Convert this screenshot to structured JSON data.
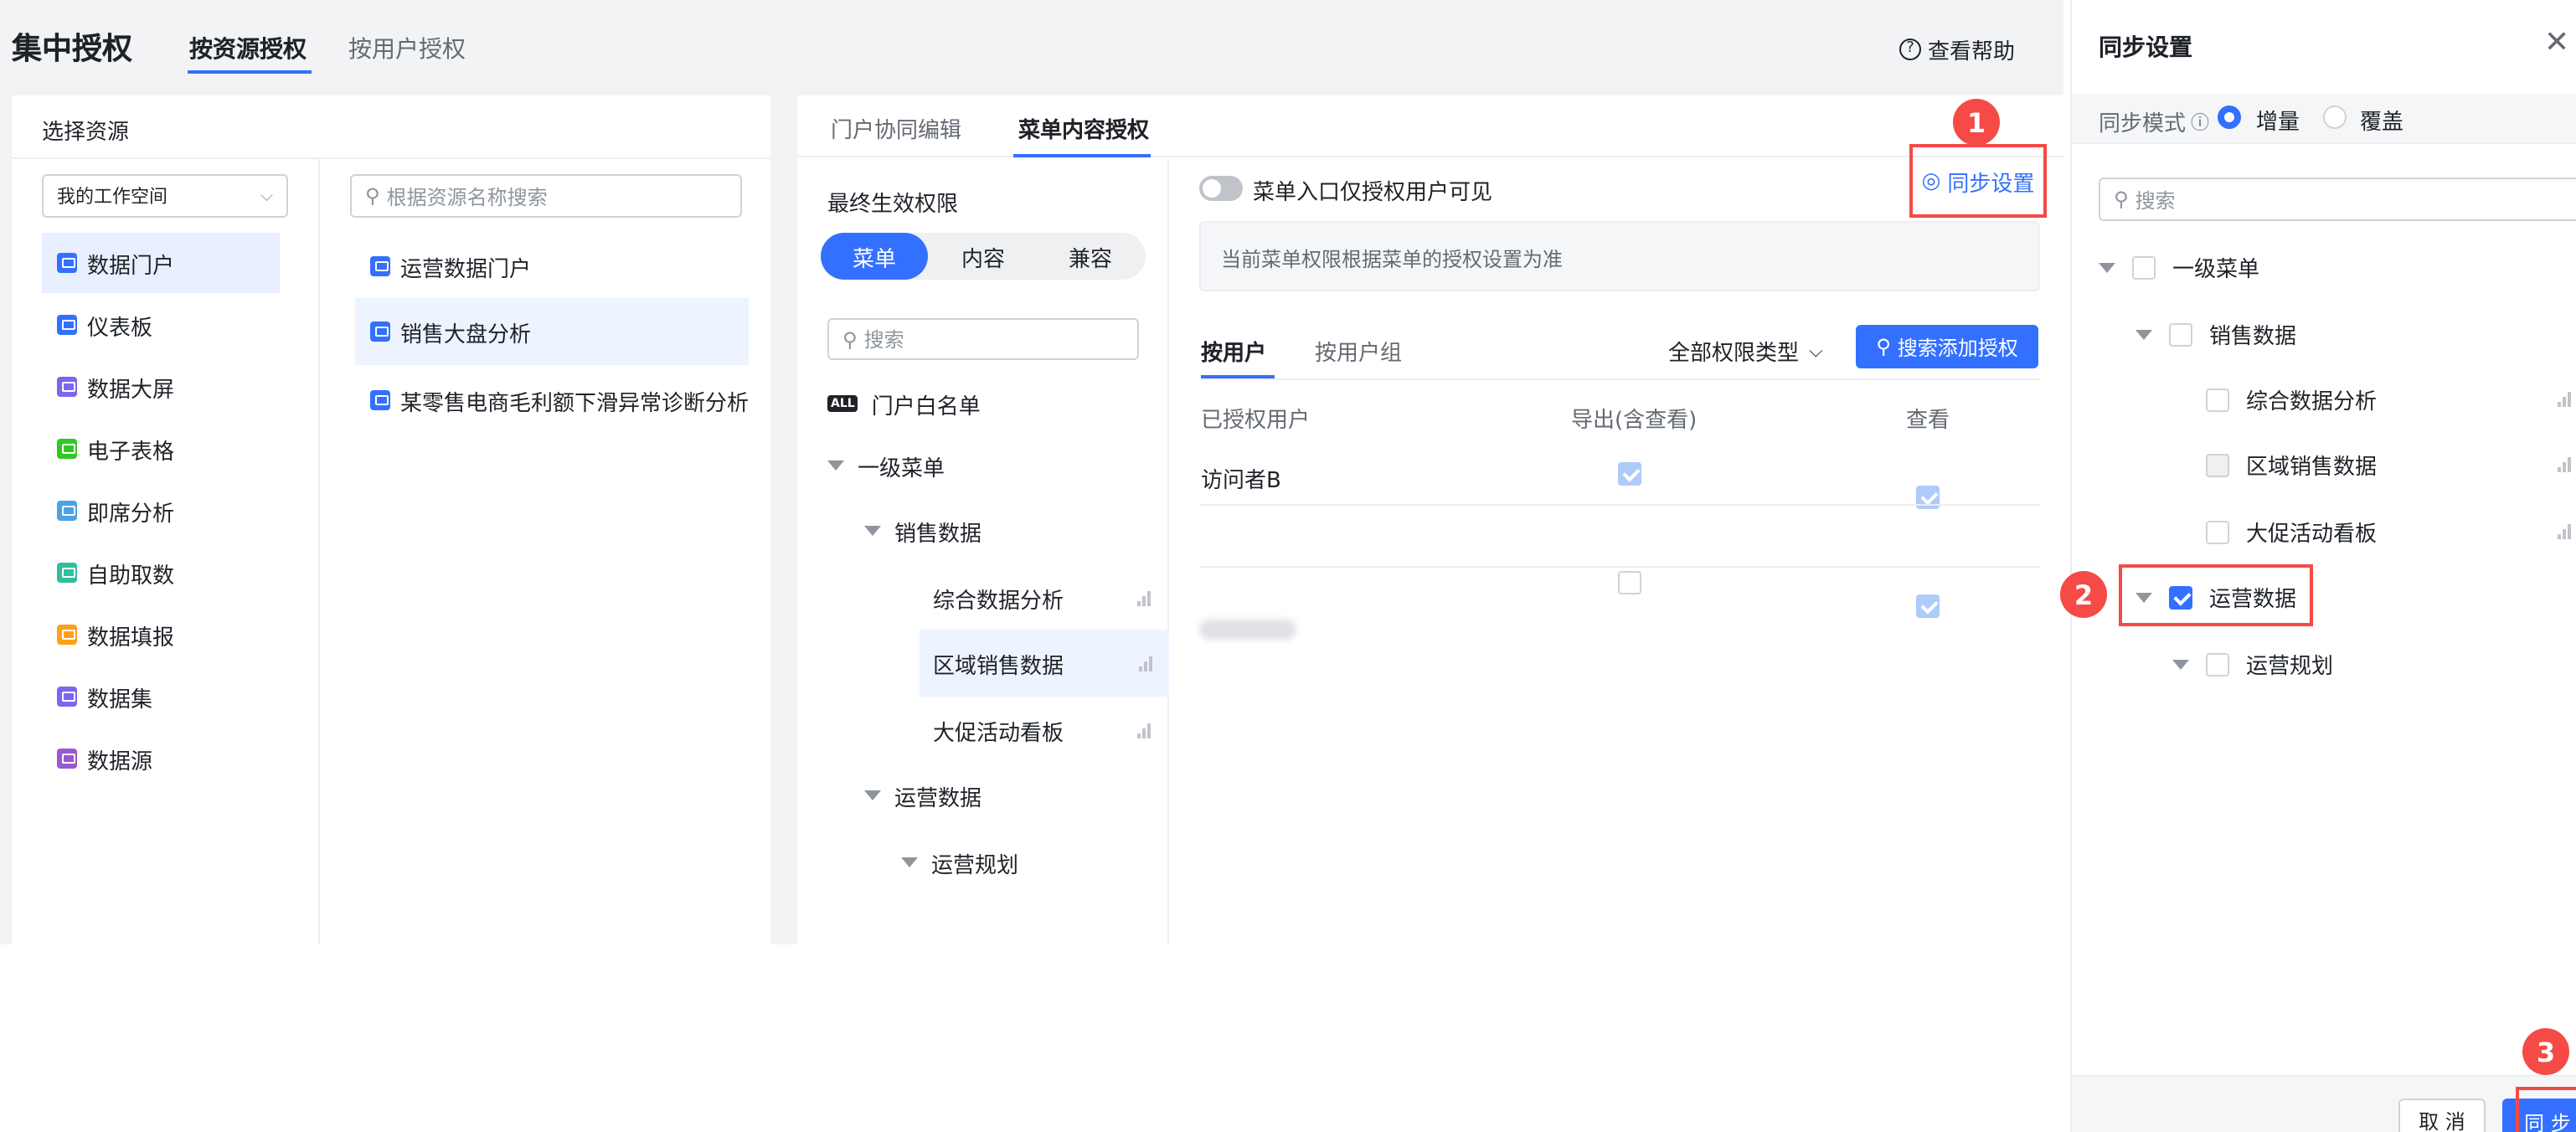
{
  "header": {
    "title": "集中授权",
    "tabs": [
      "按资源授权",
      "按用户授权"
    ],
    "help": "查看帮助"
  },
  "left": {
    "title": "选择资源",
    "workspace": "我的工作空间",
    "search_placeholder": "根据资源名称搜索",
    "categories": [
      {
        "label": "数据门户",
        "icon": "portal-icon",
        "color": "#3370ff"
      },
      {
        "label": "仪表板",
        "icon": "dashboard-icon",
        "color": "#3370ff"
      },
      {
        "label": "数据大屏",
        "icon": "bigscreen-icon",
        "color": "#7b67ee"
      },
      {
        "label": "电子表格",
        "icon": "spreadsheet-icon",
        "color": "#34c724"
      },
      {
        "label": "即席分析",
        "icon": "adhoc-icon",
        "color": "#4aa3e6"
      },
      {
        "label": "自助取数",
        "icon": "selfservice-icon",
        "color": "#2fbf9d"
      },
      {
        "label": "数据填报",
        "icon": "form-icon",
        "color": "#ff9f1a"
      },
      {
        "label": "数据集",
        "icon": "dataset-icon",
        "color": "#7b67ee"
      },
      {
        "label": "数据源",
        "icon": "datasource-icon",
        "color": "#9b59d0"
      }
    ],
    "resources": [
      "运营数据门户",
      "销售大盘分析",
      "某零售电商毛利额下滑异常诊断分析"
    ]
  },
  "middle": {
    "tabs": [
      "门户协同编辑",
      "菜单内容授权"
    ],
    "effective_title": "最终生效权限",
    "segments": [
      "菜单",
      "内容",
      "兼容"
    ],
    "tree_search_placeholder": "搜索",
    "tree": {
      "whitelist": "门户白名单",
      "all_badge": "ALL",
      "level1": "一级菜单",
      "sales": "销售数据",
      "item1": "综合数据分析",
      "item2": "区域销售数据",
      "item3": "大促活动看板",
      "ops": "运营数据",
      "ops_plan": "运营规划"
    },
    "toggle_label": "菜单入口仅授权用户可见",
    "sync_link": "同步设置",
    "info": "当前菜单权限根据菜单的授权设置为准",
    "sub_tabs": [
      "按用户",
      "按用户组"
    ],
    "perm_type": "全部权限类型",
    "add_button": "搜索添加授权",
    "columns": [
      "已授权用户",
      "导出(含查看)",
      "查看"
    ],
    "rows": [
      {
        "user": "访问者B",
        "export": true,
        "view": true
      },
      {
        "user": "",
        "export": false,
        "view": true
      }
    ]
  },
  "drawer": {
    "title": "同步设置",
    "mode_label": "同步模式",
    "mode_options": [
      "增量",
      "覆盖"
    ],
    "mode_selected": "增量",
    "search_placeholder": "搜索",
    "tree": {
      "level1": "一级菜单",
      "sales": "销售数据",
      "item1": "综合数据分析",
      "item2": "区域销售数据",
      "item3": "大促活动看板",
      "ops": "运营数据",
      "ops_plan": "运营规划"
    },
    "cancel": "取 消",
    "sync": "同 步"
  },
  "badges": [
    "1",
    "2",
    "3"
  ]
}
